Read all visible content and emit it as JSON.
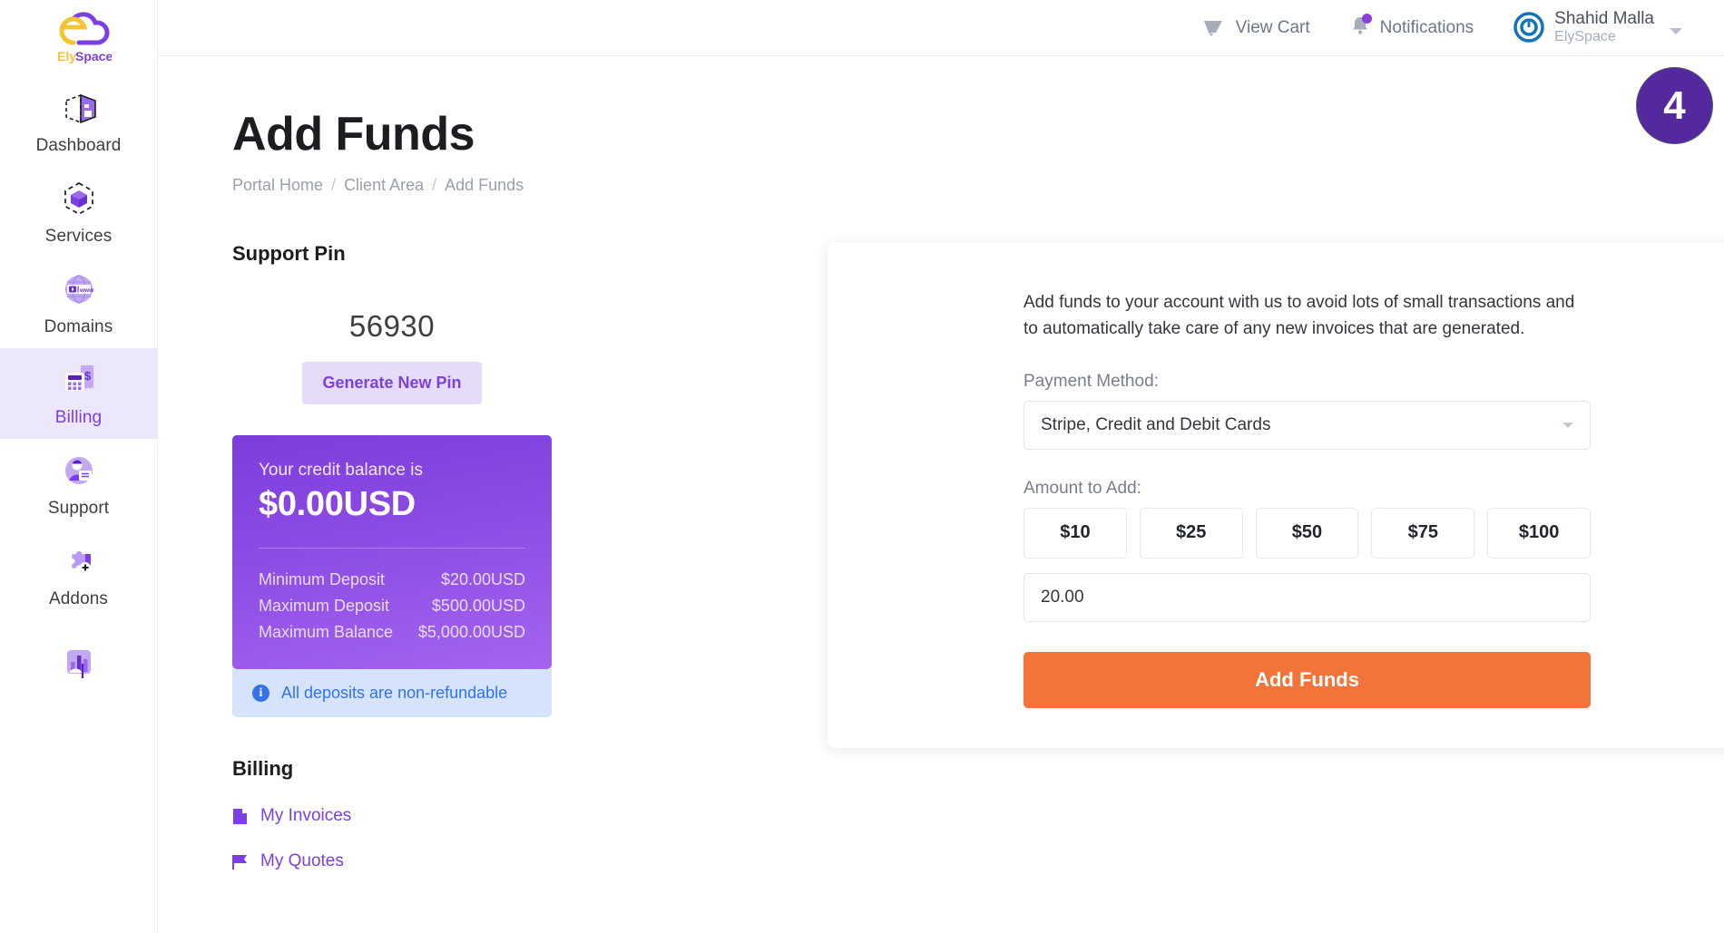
{
  "brand": {
    "name_part1": "Ely",
    "name_part2": "Space",
    "accent": "#7b3fe4",
    "accent_yellow": "#f5c430"
  },
  "sidebar": {
    "items": [
      {
        "label": "Dashboard",
        "icon": "dashboard-icon",
        "active": false
      },
      {
        "label": "Services",
        "icon": "services-cube-icon",
        "active": false
      },
      {
        "label": "Domains",
        "icon": "domains-globe-icon",
        "active": false
      },
      {
        "label": "Billing",
        "icon": "billing-calculator-icon",
        "active": true
      },
      {
        "label": "Support",
        "icon": "support-agent-icon",
        "active": false
      },
      {
        "label": "Addons",
        "icon": "addons-puzzle-icon",
        "active": false
      },
      {
        "label": "",
        "icon": "reports-chart-icon",
        "active": false
      }
    ]
  },
  "topbar": {
    "cart_label": "View Cart",
    "cart_icon": "cart-icon",
    "notifications_label": "Notifications",
    "notifications_icon": "bell-icon",
    "notifications_dot_color": "#8a3fe0",
    "user_name": "Shahid Malla",
    "user_org": "ElySpace",
    "user_avatar_icon": "power-avatar-icon",
    "caret_icon": "chevron-down-icon"
  },
  "step_badge": {
    "number": "4",
    "color": "#54289e"
  },
  "page": {
    "title": "Add Funds",
    "breadcrumb": [
      {
        "label": "Portal Home"
      },
      {
        "label": "Client Area"
      },
      {
        "label": "Add Funds"
      }
    ],
    "breadcrumb_separator": "/"
  },
  "support_pin": {
    "heading": "Support Pin",
    "value": "56930",
    "generate_label": "Generate New Pin"
  },
  "balance_card": {
    "label": "Your credit balance is",
    "amount": "$0.00USD",
    "rows": [
      {
        "name": "Minimum Deposit",
        "value": "$20.00USD"
      },
      {
        "name": "Maximum Deposit",
        "value": "$500.00USD"
      },
      {
        "name": "Maximum Balance",
        "value": "$5,000.00USD"
      }
    ],
    "gradient_from": "#7d3ddb",
    "gradient_to": "#a464ef"
  },
  "alert": {
    "icon": "info-icon",
    "glyph": "i",
    "text": "All deposits are non-refundable",
    "color": "#3572e8",
    "background": "#d6e4fb"
  },
  "billing_links": {
    "heading": "Billing",
    "items": [
      {
        "label": "My Invoices",
        "icon": "document-icon"
      },
      {
        "label": "My Quotes",
        "icon": "flag-icon"
      }
    ]
  },
  "add_funds_form": {
    "intro": "Add funds to your account with us to avoid lots of small transactions and to automatically take care of any new invoices that are generated.",
    "payment_method_label": "Payment Method:",
    "payment_method_value": "Stripe, Credit and Debit Cards",
    "payment_method_options": [
      "Stripe, Credit and Debit Cards"
    ],
    "amount_label": "Amount to Add:",
    "amount_presets": [
      "$10",
      "$25",
      "$50",
      "$75",
      "$100"
    ],
    "amount_value": "20.00",
    "amount_placeholder": "",
    "submit_label": "Add Funds",
    "submit_color": "#f2743a"
  }
}
